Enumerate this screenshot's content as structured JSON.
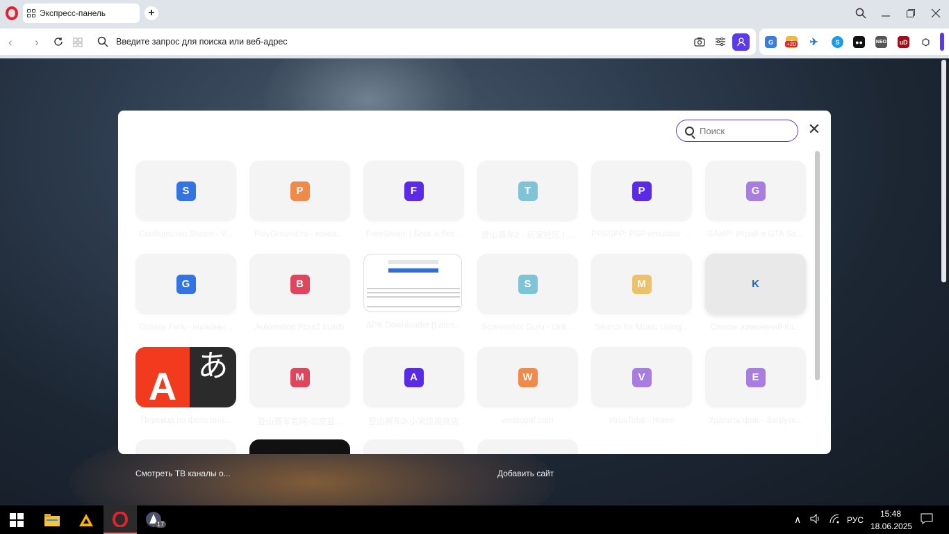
{
  "browser": {
    "tab_title": "Экспресс-панель",
    "new_tab_symbol": "+",
    "address_placeholder": "Введите запрос для поиска или веб-адрес",
    "extension_badge": "+20"
  },
  "modal": {
    "search_placeholder": "Поиск",
    "close_symbol": "✕",
    "tiles": [
      {
        "letter": "S",
        "color": "#3274e3",
        "title": "Сообщество Steam - V...",
        "type": "letter"
      },
      {
        "letter": "P",
        "color": "#f08a48",
        "title": "PlayGround.ru - компь...",
        "type": "letter"
      },
      {
        "letter": "F",
        "color": "#5b2ae8",
        "title": "FreeSteam | Блог о бес...",
        "type": "letter"
      },
      {
        "letter": "T",
        "color": "#7ec3d6",
        "title": "登山赛车2 - 玩家社区 | ...",
        "type": "letter"
      },
      {
        "letter": "P",
        "color": "#5b2ae8",
        "title": "PPSSPP: PSP emulator f...",
        "type": "letter"
      },
      {
        "letter": "G",
        "color": "#a77ddf",
        "title": "SAMP: Играй в GTA Sa...",
        "type": "letter"
      },
      {
        "letter": "G",
        "color": "#3274e3",
        "title": "Greasy Fork - полезны...",
        "type": "letter"
      },
      {
        "letter": "B",
        "color": "#e0455c",
        "title": "Automated Pcsx2 builds",
        "type": "letter"
      },
      {
        "letter": "",
        "color": "",
        "title": "APK Downloader [Lates...",
        "type": "apk"
      },
      {
        "letter": "S",
        "color": "#7ec3d6",
        "title": "Screenshot Guru - Onli...",
        "type": "letter"
      },
      {
        "letter": "M",
        "color": "#edc06a",
        "title": "Search for Music Using...",
        "type": "letter"
      },
      {
        "letter": "K",
        "color": "#1f63b5",
        "title": "Список изменений Ка...",
        "type": "k"
      },
      {
        "letter": "",
        "color": "",
        "title": "Перевод по фото онл...",
        "type": "translate"
      },
      {
        "letter": "M",
        "color": "#e0455c",
        "title": "登山赛车官网-北京蓝...",
        "type": "letter"
      },
      {
        "letter": "A",
        "color": "#5b2ae8",
        "title": "登山赛车2-小米应用商店",
        "type": "letter"
      },
      {
        "letter": "W",
        "color": "#f08a48",
        "title": "webtopdf.com",
        "type": "letter"
      },
      {
        "letter": "V",
        "color": "#a77ddf",
        "title": "VirusTotal - Home",
        "type": "letter"
      },
      {
        "letter": "E",
        "color": "#a77ddf",
        "title": "Удалить фон - Загрузк...",
        "type": "letter"
      }
    ]
  },
  "background_labels": {
    "tv": "Смотреть ТВ каналы о...",
    "add_site": "Добавить сайт"
  },
  "translate_thumb": {
    "latin": "A",
    "kana": "あ"
  },
  "taskbar": {
    "badge": "17",
    "lang": "РУС",
    "time": "15:48",
    "date": "18.06.2025"
  }
}
